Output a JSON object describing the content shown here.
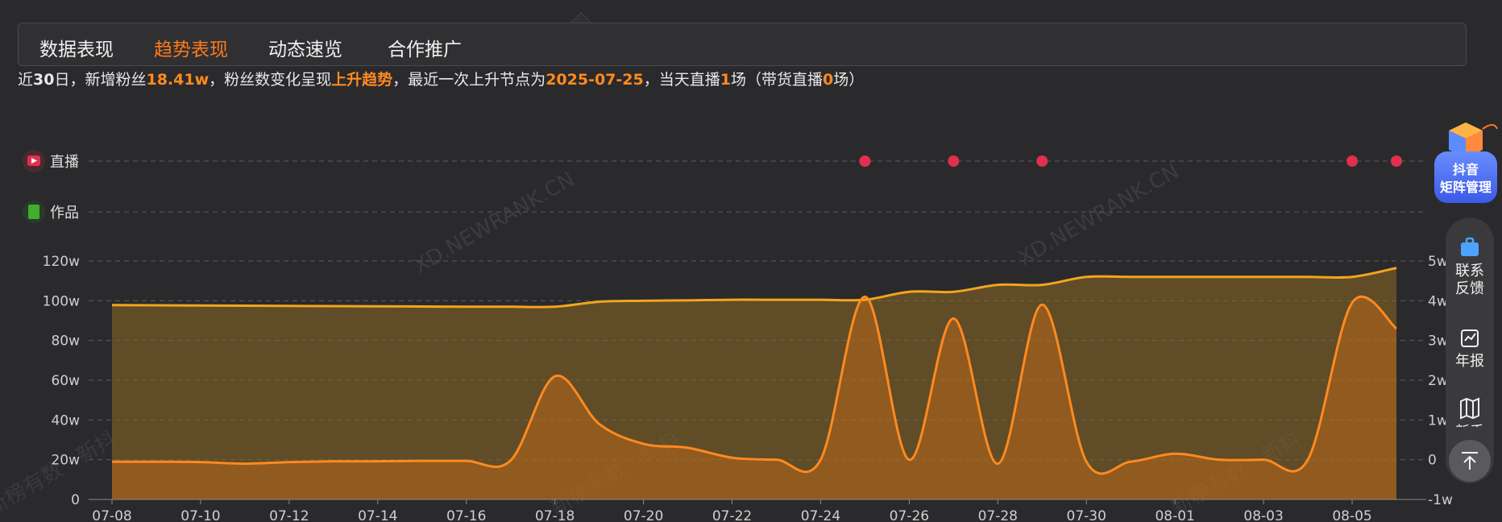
{
  "tabs": [
    {
      "label": "数据表现",
      "active": false
    },
    {
      "label": "趋势表现",
      "active": true
    },
    {
      "label": "动态速览",
      "active": false
    },
    {
      "label": "合作推广",
      "active": false
    }
  ],
  "summary": {
    "p1": "近",
    "days": "30",
    "p2": "日，新增粉丝",
    "new_fans": "18.41w",
    "p3": "，粉丝数变化呈现",
    "trend": "上升趋势",
    "p4": "，最近一次上升节点为",
    "date": "2025-07-25",
    "p5": "，当天直播",
    "live_count": "1",
    "p6": "场（带货直播",
    "sales_live": "0",
    "p7": "场）"
  },
  "rows": {
    "live_label": "直播",
    "works_label": "作品"
  },
  "watermark": "XD.NEWRANK.CN",
  "watermark2": "新榜有数 · 新抖",
  "colors": {
    "accent": "#ff7a1a",
    "fans_line": "#f2a51c",
    "growth_line": "#ff8a1f",
    "live_dot": "#e0304e",
    "works_icon": "#3fae2a"
  },
  "chart_data": {
    "type": "area",
    "x": [
      "07-08",
      "07-09",
      "07-10",
      "07-11",
      "07-12",
      "07-13",
      "07-14",
      "07-15",
      "07-16",
      "07-17",
      "07-18",
      "07-19",
      "07-20",
      "07-21",
      "07-22",
      "07-23",
      "07-24",
      "07-25",
      "07-26",
      "07-27",
      "07-28",
      "07-29",
      "07-30",
      "07-31",
      "08-01",
      "08-02",
      "08-03",
      "08-04",
      "08-05",
      "08-06"
    ],
    "x_ticks": [
      "07-08",
      "07-10",
      "07-12",
      "07-14",
      "07-16",
      "07-18",
      "07-20",
      "07-22",
      "07-24",
      "07-26",
      "07-28",
      "07-30",
      "08-01",
      "08-03",
      "08-05"
    ],
    "y_left_ticks": [
      "0",
      "20w",
      "40w",
      "60w",
      "80w",
      "100w",
      "120w"
    ],
    "y_left_range": [
      0,
      120
    ],
    "y_right_ticks": [
      "-1w",
      "0",
      "1w",
      "2w",
      "3w",
      "4w",
      "5w"
    ],
    "y_right_range": [
      -1,
      5
    ],
    "series": [
      {
        "axis": "left",
        "values": [
          97.8,
          97.7,
          97.6,
          97.5,
          97.4,
          97.3,
          97.2,
          97.1,
          97.0,
          97.0,
          97.0,
          99.5,
          100.0,
          100.2,
          100.5,
          100.5,
          100.5,
          100.5,
          104.5,
          104.5,
          108.0,
          108.0,
          112.0,
          112.0,
          112.0,
          112.0,
          112.0,
          112.0,
          112.0,
          116.5
        ]
      },
      {
        "axis": "right",
        "values": [
          -0.05,
          -0.05,
          -0.06,
          -0.1,
          -0.06,
          -0.04,
          -0.04,
          -0.03,
          -0.03,
          -0.02,
          2.1,
          0.9,
          0.4,
          0.3,
          0.05,
          0.0,
          0.0,
          4.1,
          0.0,
          3.55,
          -0.1,
          3.9,
          -0.05,
          -0.05,
          0.15,
          0.0,
          0.0,
          0.0,
          3.95,
          3.3
        ]
      }
    ],
    "live_dates": [
      "07-25",
      "07-27",
      "07-29",
      "08-05",
      "08-06"
    ],
    "works_dates": []
  },
  "side": {
    "matrix": [
      "抖音",
      "矩阵管理"
    ],
    "feedback": [
      "联系",
      "反馈"
    ],
    "annual": "年报",
    "guide": "新手"
  }
}
